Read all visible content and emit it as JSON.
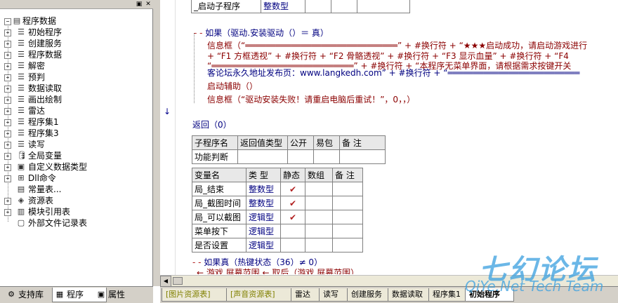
{
  "tree": {
    "root_label": "程序数据",
    "items": [
      {
        "label": "初始程序",
        "icon": "module-icon"
      },
      {
        "label": "创建服务",
        "icon": "module-icon"
      },
      {
        "label": "程序数据",
        "icon": "module-icon"
      },
      {
        "label": "解密",
        "icon": "module-icon"
      },
      {
        "label": "预判",
        "icon": "module-icon"
      },
      {
        "label": "数据读取",
        "icon": "module-icon"
      },
      {
        "label": "画出绘制",
        "icon": "module-icon"
      },
      {
        "label": "雷达",
        "icon": "module-icon"
      },
      {
        "label": "程序集1",
        "icon": "module-icon"
      },
      {
        "label": "程序集3",
        "icon": "module-icon"
      },
      {
        "label": "读写",
        "icon": "module-icon"
      },
      {
        "label": "全局变量",
        "icon": "global-var-icon"
      },
      {
        "label": "自定义数据类型",
        "icon": "custom-type-icon"
      },
      {
        "label": "Dll命令",
        "icon": "dll-icon"
      },
      {
        "label": "常量表...",
        "icon": "constant-icon"
      },
      {
        "label": "资源表",
        "icon": "resource-icon"
      },
      {
        "label": "模块引用表",
        "icon": "module-ref-icon"
      },
      {
        "label": "外部文件记录表",
        "icon": "file-record-icon"
      }
    ]
  },
  "left_tabs": [
    {
      "label": "支持库",
      "icon": "library-icon"
    },
    {
      "label": "程序",
      "icon": "program-icon"
    },
    {
      "label": "属性",
      "icon": "property-icon"
    }
  ],
  "code": {
    "top_table": {
      "cells": [
        "_启动子程序",
        "整数型"
      ]
    },
    "lines": {
      "if_line": "如果（驱动.安装驱动（）＝ 真）",
      "msg1a": "信息框（“══════════════════════════════” + #换行符 + “★★★启动成功，请启动游戏进行",
      "msg1b": "+ “F1 方框透视” + #换行符 + “F2 骨骼透视” + #换行符 + “F3 显示血量” + #换行符 + “F4",
      "msg1c": "“════════════════════════════” + #换行符 + “本程序无菜单界面，请根据需求按键开关",
      "msg1d": "客论坛永久地址发布页：www.langkedh.com” + #换行符 + “══════════════════════════",
      "call_line": "启动辅助（）",
      "msg2": "信息框（“驱动安装失败！请重启电脑后重试！”，0，，）",
      "return_line": "返回（0）",
      "if_line2": "如果真（热键状态（36）≠ 0）",
      "partial_line": "← 游戏 屏幕范围 ← 取后（游戏 屏幕范围）"
    },
    "sub_table": {
      "headers": [
        "子程序名",
        "返回值类型",
        "公开",
        "易包",
        "备 注"
      ],
      "row": [
        "功能判断",
        "",
        "",
        "",
        ""
      ]
    },
    "var_table": {
      "headers": [
        "变量名",
        "类 型",
        "静态",
        "数组",
        "备 注"
      ],
      "rows": [
        {
          "name": "局_结束",
          "type": "整数型",
          "static": "✔"
        },
        {
          "name": "局_截图时间",
          "type": "整数型",
          "static": "✔"
        },
        {
          "name": "局_可以截图",
          "type": "逻辑型",
          "static": "✔"
        },
        {
          "name": "菜单按下",
          "type": "逻辑型",
          "static": ""
        },
        {
          "name": "是否设置",
          "type": "逻辑型",
          "static": ""
        }
      ]
    }
  },
  "code_tabs": [
    {
      "label": "[图片资源表]",
      "kind": "res"
    },
    {
      "label": "[声音资源表]",
      "kind": "res"
    },
    {
      "label": "雷达",
      "kind": "normal"
    },
    {
      "label": "读写",
      "kind": "normal"
    },
    {
      "label": "创建服务",
      "kind": "normal"
    },
    {
      "label": "数据读取",
      "kind": "normal"
    },
    {
      "label": "程序集1",
      "kind": "normal"
    },
    {
      "label": "初始程序",
      "kind": "active"
    }
  ],
  "watermark": {
    "line1": "七幻论坛",
    "line2": "QiYe.Net Tech Team"
  },
  "colors": {
    "keyword": "#000080",
    "string": "#8b0000",
    "flow": "#b22222",
    "watermark": "#3aa0e0"
  }
}
